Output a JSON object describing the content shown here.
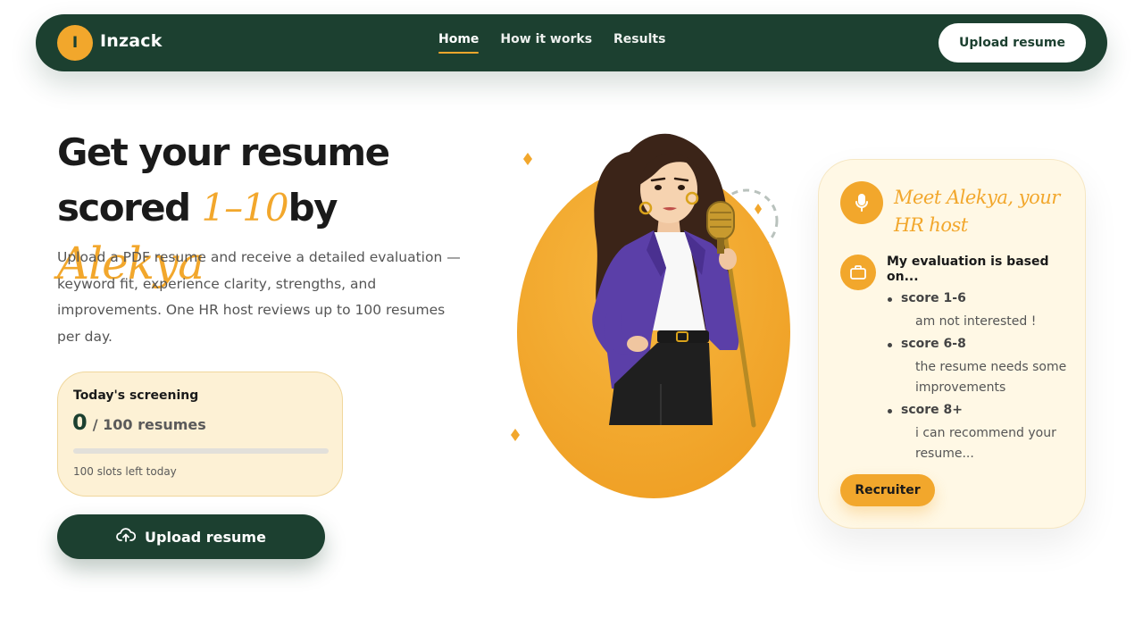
{
  "header": {
    "logo_letter": "I",
    "brand": "Inzack",
    "nav": [
      {
        "label": "Home",
        "active": true
      },
      {
        "label": "How it works",
        "active": false
      },
      {
        "label": "Results",
        "active": false
      }
    ],
    "cta_label": "Upload resume"
  },
  "hero": {
    "title_line1": "Get your resume",
    "title_line2_prefix": "scored ",
    "title_range": "1–10",
    "title_by": "by ",
    "title_name": "Alekya",
    "description": "Upload a PDF resume and receive a detailed evaluation — keyword fit, experience clarity, strengths, and improvements. One HR host reviews up to 100 resumes per day.",
    "stats": {
      "label": "Today's screening",
      "count": "0",
      "total_text": "/ 100 resumes",
      "progress_fraction": 0,
      "note": "100 slots left today"
    },
    "upload_button_label": "Upload resume",
    "upload_icon": "cloud-upload-icon"
  },
  "host_card": {
    "icon": "microphone-icon",
    "title": "Meet Alekya, your HR host",
    "eval_icon": "briefcase-icon",
    "eval_title": "My evaluation is based on...",
    "scores": [
      {
        "range": "score 1-6",
        "text": "am not interested !"
      },
      {
        "range": "score 6-8",
        "text": "the resume needs some improvements"
      },
      {
        "range": "score 8+",
        "text": "i can recommend your resume..."
      }
    ],
    "role_button_label": "Recruiter"
  },
  "colors": {
    "primary_green": "#1c4030",
    "accent_orange": "#f2a72c",
    "stats_bg": "#fdf1d5",
    "card_bg": "#fff8e5"
  }
}
